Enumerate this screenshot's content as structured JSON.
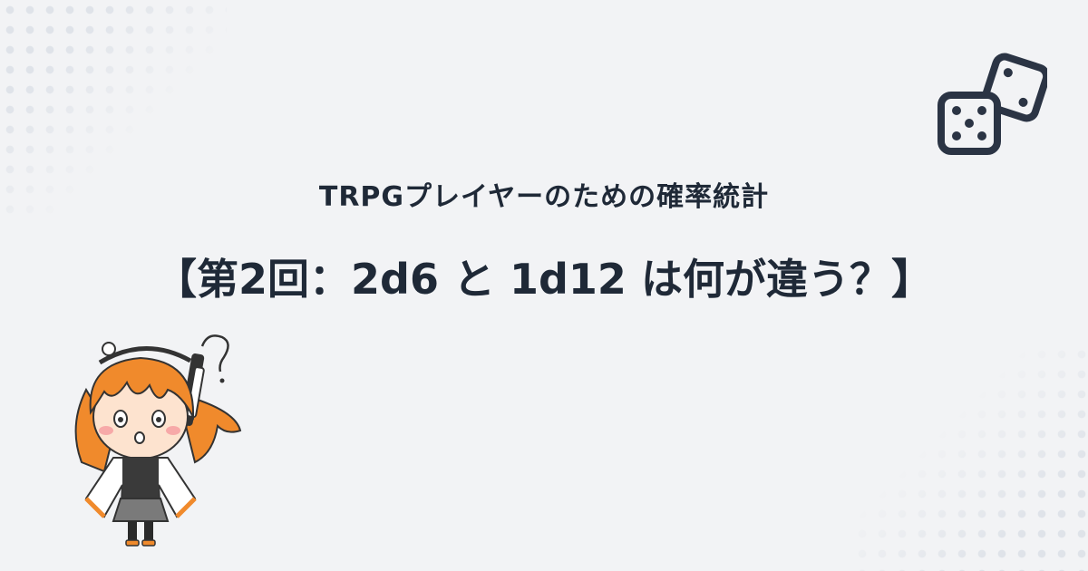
{
  "header": {
    "subtitle": "TRPGプレイヤーのための確率統計",
    "title": "【第2回：2d6 と 1d12 は何が違う？】"
  },
  "icons": {
    "dice": "dice-icon",
    "character": "character-illustration"
  },
  "colors": {
    "background": "#f2f3f5",
    "text": "#1f2937",
    "dots": "#dfe3e9",
    "hair": "#f08a2c"
  }
}
